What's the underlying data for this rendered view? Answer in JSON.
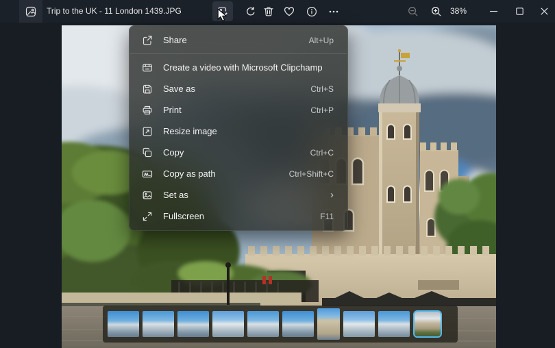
{
  "titlebar": {
    "title": "Trip to the UK - 11 London 1439.JPG",
    "zoom_level": "38%",
    "gallery_icon": "photo-gallery-icon",
    "toolbar_icons": [
      "edit-image-icon",
      "rotate-icon",
      "delete-icon",
      "favorite-icon",
      "info-icon",
      "see-more-icon"
    ],
    "zoom_icons": [
      "zoom-out-icon",
      "zoom-in-icon"
    ],
    "window_controls": [
      "minimize",
      "maximize",
      "close"
    ]
  },
  "context_menu": {
    "items": [
      {
        "label": "Share",
        "shortcut": "Alt+Up",
        "icon": "share-icon"
      },
      {
        "label": "Create a video with Microsoft Clipchamp",
        "shortcut": "",
        "icon": "clipchamp-video-icon"
      },
      {
        "label": "Save as",
        "shortcut": "Ctrl+S",
        "icon": "save-icon"
      },
      {
        "label": "Print",
        "shortcut": "Ctrl+P",
        "icon": "printer-icon"
      },
      {
        "label": "Resize image",
        "shortcut": "",
        "icon": "resize-image-icon"
      },
      {
        "label": "Copy",
        "shortcut": "Ctrl+C",
        "icon": "copy-icon"
      },
      {
        "label": "Copy as path",
        "shortcut": "Ctrl+Shift+C",
        "icon": "copy-path-icon"
      },
      {
        "label": "Set as",
        "shortcut": "",
        "chevron": "›",
        "has_submenu": true,
        "icon": "set-as-icon"
      },
      {
        "label": "Fullscreen",
        "shortcut": "F11",
        "icon": "fullscreen-icon"
      }
    ]
  },
  "filmstrip": {
    "thumbnail_count": 10,
    "selected_index": 9,
    "accent_color": "#53b9ec"
  },
  "photo": {
    "description": "Tower of London stone keep with domed turret and golden weathervane, large green tree at left, dramatic cloudy sky, crenellated outer wall"
  },
  "colors": {
    "titlebar_bg": "#1b2128",
    "window_bg": "#181d24",
    "menu_bg": "rgba(38,41,37,0.78)",
    "accent_blue": "#53b9ec"
  }
}
